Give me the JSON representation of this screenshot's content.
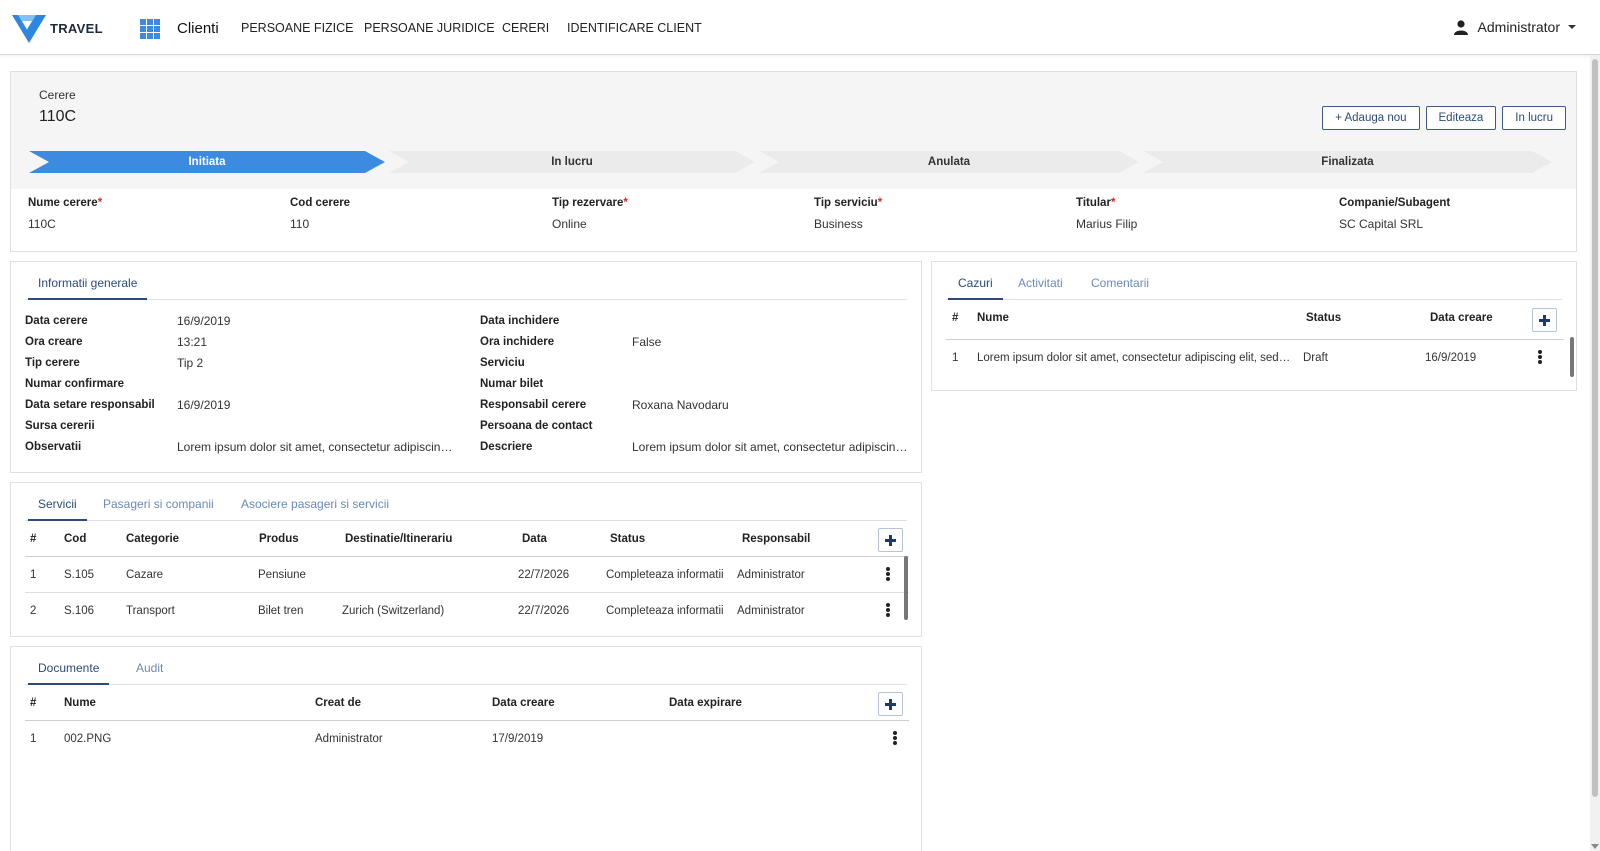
{
  "nav": {
    "logo_text": "TRAVEL",
    "brand": "Clienti",
    "links": [
      "PERSOANE FIZICE",
      "PERSOANE JURIDICE",
      "CERERI",
      "IDENTIFICARE CLIENT"
    ],
    "user": "Administrator"
  },
  "header": {
    "label": "Cerere",
    "title": "110C",
    "buttons": {
      "add": "+ Adauga nou",
      "edit": "Editeaza",
      "in_progress": "In lucru"
    },
    "steps": [
      "Initiata",
      "In lucru",
      "Anulata",
      "Finalizata"
    ],
    "fields": [
      {
        "label": "Nume cerere",
        "required": "*",
        "value": "110C"
      },
      {
        "label": "Cod cerere",
        "required": "",
        "value": "110"
      },
      {
        "label": "Tip rezervare",
        "required": "*",
        "value": "Online"
      },
      {
        "label": "Tip serviciu",
        "required": "*",
        "value": "Business"
      },
      {
        "label": "Titular",
        "required": "*",
        "value": "Marius Filip"
      },
      {
        "label": "Companie/Subagent",
        "required": "",
        "value": "SC Capital SRL"
      }
    ]
  },
  "general": {
    "tab": "Informatii generale",
    "left": [
      {
        "label": "Data cerere",
        "value": "16/9/2019"
      },
      {
        "label": "Ora creare",
        "value": "13:21"
      },
      {
        "label": "Tip cerere",
        "value": "Tip 2"
      },
      {
        "label": "Numar confirmare",
        "value": ""
      },
      {
        "label": "Data setare responsabil",
        "value": "16/9/2019"
      },
      {
        "label": "Sursa cererii",
        "value": ""
      },
      {
        "label": "Observatii",
        "value": "Lorem ipsum dolor sit amet, consectetur adipiscing elit, sed do eiusmod"
      }
    ],
    "right": [
      {
        "label": "Data inchidere",
        "value": ""
      },
      {
        "label": "Ora inchidere",
        "value": "False"
      },
      {
        "label": "Serviciu",
        "value": ""
      },
      {
        "label": "Numar bilet",
        "value": ""
      },
      {
        "label": "Responsabil cerere",
        "value": "Roxana Navodaru"
      },
      {
        "label": "Persoana de contact",
        "value": ""
      },
      {
        "label": "Descriere",
        "value": "Lorem ipsum dolor sit amet, consectetur adipiscing elit, sed do eiusmod"
      }
    ]
  },
  "cases": {
    "tabs": [
      "Cazuri",
      "Activitati",
      "Comentarii"
    ],
    "columns": [
      "#",
      "Nume",
      "Status",
      "Data creare"
    ],
    "rows": [
      {
        "num": "1",
        "name": "Lorem ipsum dolor sit amet, consectetur adipiscing elit, sed do eiusmod tempor",
        "status": "Draft",
        "date": "16/9/2019"
      }
    ]
  },
  "services": {
    "tabs": [
      "Servicii",
      "Pasageri si companii",
      "Asociere pasageri si servicii"
    ],
    "columns": [
      "#",
      "Cod",
      "Categorie",
      "Produs",
      "Destinatie/Itinerariu",
      "Data",
      "Status",
      "Responsabil"
    ],
    "rows": [
      {
        "num": "1",
        "code": "S.105",
        "category": "Cazare",
        "product": "Pensiune",
        "destination": "",
        "date": "22/7/2026",
        "status": "Completeaza informatii",
        "owner": "Administrator"
      },
      {
        "num": "2",
        "code": "S.106",
        "category": "Transport",
        "product": "Bilet tren",
        "destination": "Zurich (Switzerland)",
        "date": "22/7/2026",
        "status": "Completeaza informatii",
        "owner": "Administrator"
      }
    ]
  },
  "documents": {
    "tabs": [
      "Documente",
      "Audit"
    ],
    "columns": [
      "#",
      "Nume",
      "Creat de",
      "Data creare",
      "Data expirare"
    ],
    "rows": [
      {
        "num": "1",
        "name": "002.PNG",
        "creator": "Administrator",
        "created": "17/9/2019",
        "expires": ""
      }
    ]
  },
  "colors": {
    "primary": "#3d8be0",
    "navy": "#2c4b78",
    "required": "#d02a2a"
  }
}
